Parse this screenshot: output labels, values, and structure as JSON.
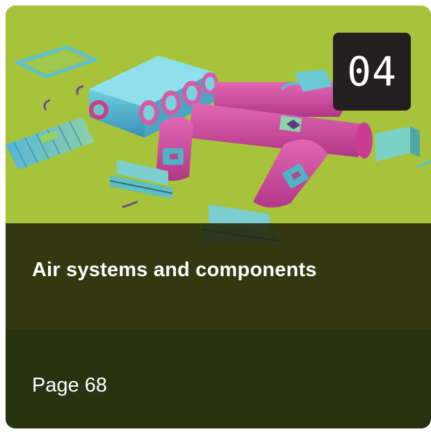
{
  "card": {
    "number": "04",
    "title": "Air systems and components",
    "page": "Page 68",
    "image": "air-duct-system-illustration"
  },
  "colors": {
    "background": "#a6c33b",
    "badge": "#231f20",
    "title_band": "#24240a",
    "page_band": "#283311",
    "duct_magenta": "#d64aa0",
    "duct_cyan": "#4fb7c9"
  }
}
